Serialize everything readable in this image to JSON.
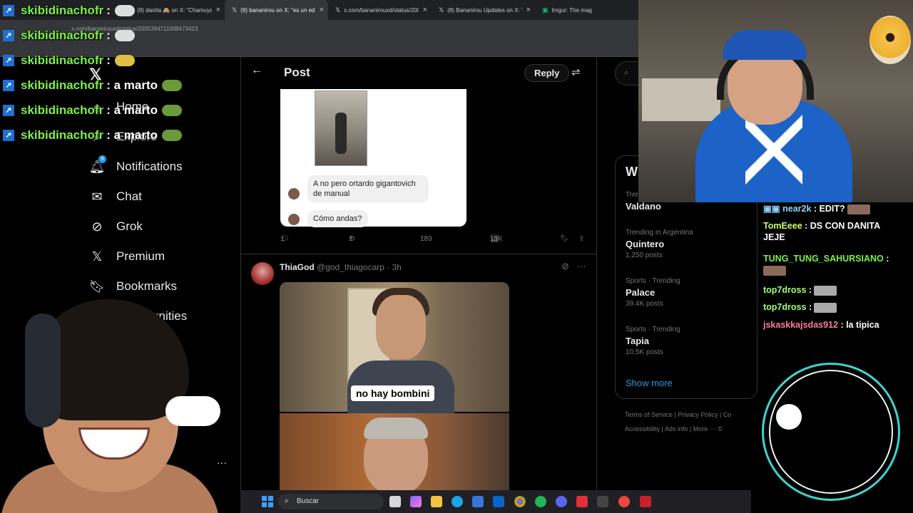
{
  "browser": {
    "tabs": [
      {
        "label": "(9) danita 🙈 on X: \"Chamuyan",
        "icon": "x-logo-icon",
        "active": false
      },
      {
        "label": "(9) bananirou on X: \"es un edit",
        "icon": "x-logo-icon",
        "active": true
      },
      {
        "label": "x.com/bananirouxd/status/200",
        "icon": "x-logo-icon",
        "active": false
      },
      {
        "label": "(8) Bananirou Updates on X: \"",
        "icon": "x-logo-icon",
        "active": false
      },
      {
        "label": "Imgur: The mag",
        "icon": "imgur-icon",
        "active": false
      }
    ],
    "address": "x.com/bananirouxd/status/2005394711008473423"
  },
  "nav": {
    "items": [
      {
        "label": "Home",
        "icon": "home-icon"
      },
      {
        "label": "Explore",
        "icon": "search-icon"
      },
      {
        "label": "Notifications",
        "icon": "bell-icon",
        "badge": "9"
      },
      {
        "label": "Chat",
        "icon": "mail-icon"
      },
      {
        "label": "Grok",
        "icon": "grok-icon"
      },
      {
        "label": "Premium",
        "icon": "x-logo-icon"
      },
      {
        "label": "Bookmarks",
        "icon": "bookmark-icon"
      },
      {
        "label": "Communities",
        "icon": "communities-icon"
      }
    ],
    "more": "···"
  },
  "post": {
    "header_title": "Post",
    "reply_label": "Reply",
    "chat_messages": [
      "A no pero ortardo gigantovich de manual",
      "Cómo andas?"
    ],
    "stats": {
      "replies": "1",
      "reposts": "2",
      "likes": "189",
      "views": "15K"
    }
  },
  "tweet2": {
    "name": "ThiaGod",
    "handle": "@god_thiagocarp · 3h",
    "caption": "no hay bombini"
  },
  "right": {
    "search_placeholder": "S",
    "panel_title": "Wh",
    "trends": [
      {
        "category": "Tren",
        "name": "Valdano",
        "count": ""
      },
      {
        "category": "Trending in Argentina",
        "name": "Quintero",
        "count": "1,250 posts"
      },
      {
        "category": "Sports · Trending",
        "name": "Palace",
        "count": "39.4K posts"
      },
      {
        "category": "Sports · Trending",
        "name": "Tapia",
        "count": "10.5K posts"
      }
    ],
    "show_more": "Show more",
    "footer_line1": "Terms of Service  |  Privacy Policy  |  Co",
    "footer_line2": "Accessibility  |  Ads info  |  More ···  ©"
  },
  "stream_chat_left": [
    {
      "user": "skibidinachofr",
      "message": ""
    },
    {
      "user": "skibidinachofr",
      "message": ""
    },
    {
      "user": "skibidinachofr",
      "message": ""
    },
    {
      "user": "skibidinachofr",
      "message": "a marto"
    },
    {
      "user": "skibidinachofr",
      "message": "a marto"
    },
    {
      "user": "skibidinachofr",
      "message": "a marto"
    }
  ],
  "stream_chat_right": [
    {
      "user": "near2k",
      "message": "EDIT?"
    },
    {
      "user": "TomEeee",
      "message": "DS CON DANITA JEJE"
    },
    {
      "user": "TUNG_TUNG_SAHURSIANO",
      "message": ""
    },
    {
      "user": "top7dross",
      "message": ""
    },
    {
      "user": "top7dross",
      "message": ""
    },
    {
      "user": "jskaskkajsdas912",
      "message": "la tipica"
    }
  ],
  "taskbar": {
    "search_label": "Buscar"
  },
  "colors": {
    "x_blue": "#1d9bf0",
    "chat_green": "#7cf049",
    "ring_cyan": "#3fd2d0"
  }
}
